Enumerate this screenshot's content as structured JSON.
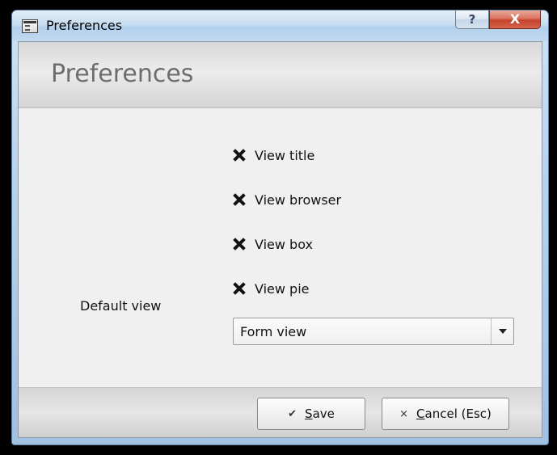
{
  "window": {
    "title": "Preferences",
    "help_glyph": "?",
    "close_glyph": "X"
  },
  "header": {
    "title": "Preferences"
  },
  "checkboxes": [
    {
      "label": "View title",
      "checked": true
    },
    {
      "label": "View browser",
      "checked": true
    },
    {
      "label": "View box",
      "checked": true
    },
    {
      "label": "View pie",
      "checked": true
    }
  ],
  "default_view": {
    "label": "Default view",
    "selected": "Form view"
  },
  "buttons": {
    "save": {
      "icon": "checkmark-icon",
      "glyph": "✔",
      "mnemonic": "S",
      "rest": "ave"
    },
    "cancel": {
      "icon": "x-icon",
      "glyph": "×",
      "mnemonic": "C",
      "rest": "ancel (Esc)"
    }
  }
}
